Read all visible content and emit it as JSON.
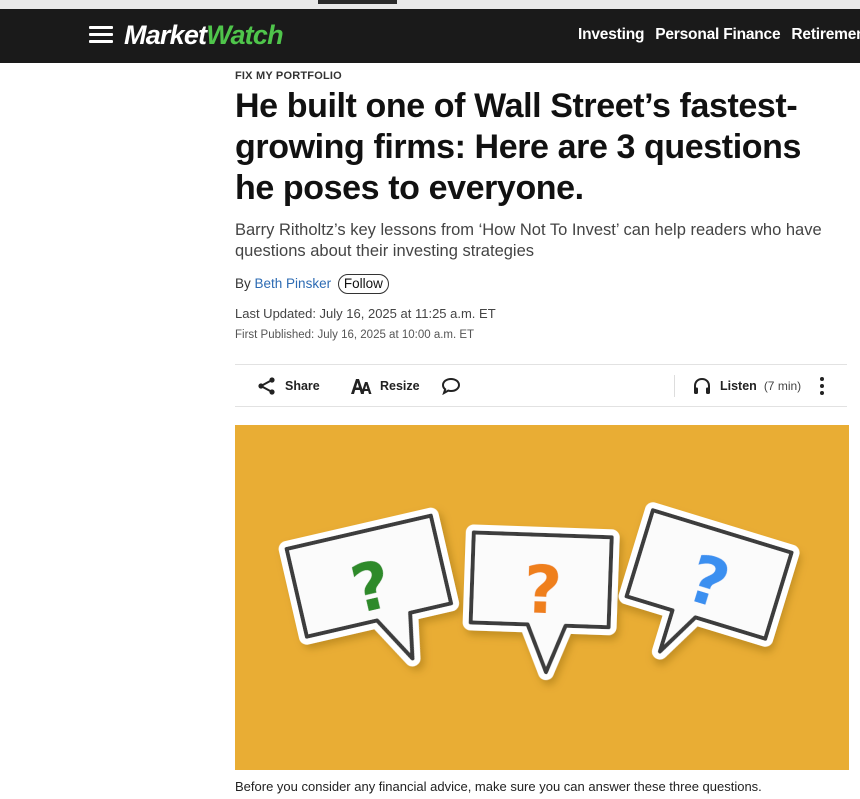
{
  "nav": {
    "logo_part1": "Market",
    "logo_part2": "Watch",
    "links": [
      "Investing",
      "Personal Finance",
      "Retirement"
    ]
  },
  "article": {
    "kicker": "FIX MY PORTFOLIO",
    "headline": "He built one of Wall Street’s fastest-growing firms: Here are 3 questions he poses to everyone.",
    "dek": "Barry Ritholtz’s key lessons from ‘How Not To Invest’ can help readers who have questions about their investing strategies",
    "by_label": "By",
    "author": "Beth Pinsker",
    "follow_label": "Follow",
    "last_updated": "Last Updated: July 16, 2025 at 11:25 a.m. ET",
    "first_published": "First Published: July 16, 2025 at 10:00 a.m. ET"
  },
  "toolbar": {
    "share_label": "Share",
    "resize_label": "Resize",
    "listen_label": "Listen",
    "listen_duration": "(7 min)"
  },
  "hero": {
    "icons": [
      "speech-bubble-icon",
      "question-mark-icon"
    ],
    "colors": {
      "background": "#e9ad34",
      "green": "#2f8a2c",
      "orange": "#ef7f1f",
      "blue": "#3a8ff0"
    }
  },
  "caption": "Before you consider any financial advice, make sure you can answer these three questions."
}
